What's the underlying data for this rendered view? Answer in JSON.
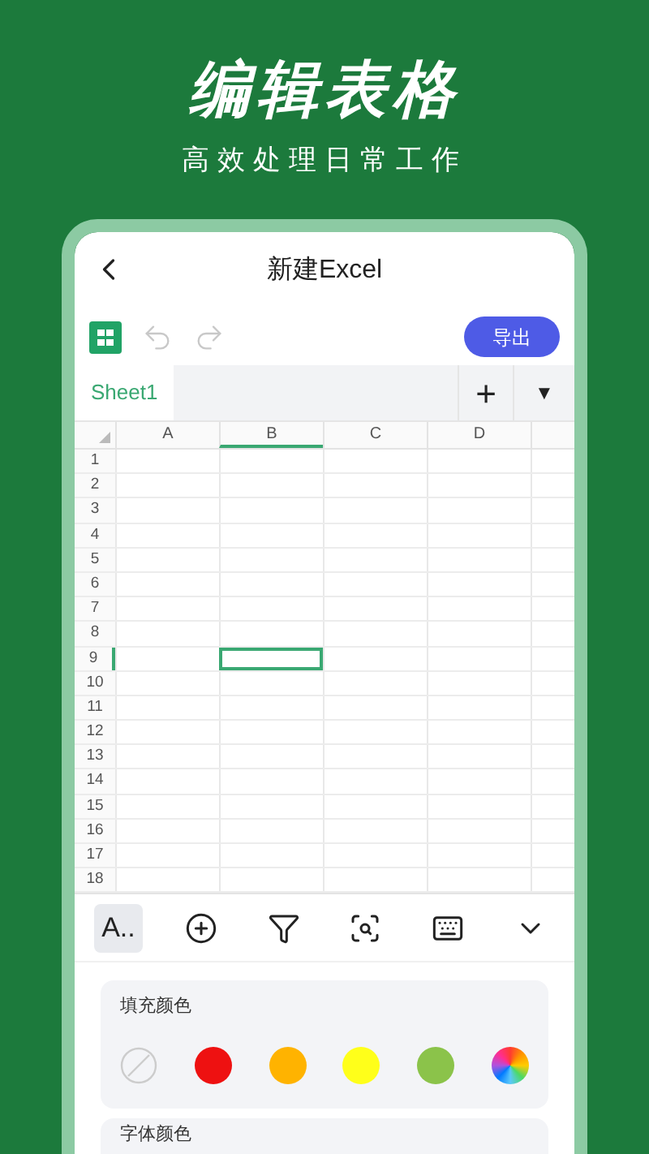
{
  "header": {
    "title": "编辑表格",
    "subtitle": "高效处理日常工作"
  },
  "screen": {
    "title": "新建Excel",
    "export_button": "导出",
    "sheet_tabs": [
      {
        "label": "Sheet1",
        "selected": true
      }
    ],
    "add_sheet": "+",
    "sheet_menu": "▼",
    "columns": [
      {
        "label": "A",
        "selected": false
      },
      {
        "label": "B",
        "selected": true
      },
      {
        "label": "C",
        "selected": false
      },
      {
        "label": "D",
        "selected": false
      }
    ],
    "rows": [
      {
        "label": "1",
        "selected": false
      },
      {
        "label": "2",
        "selected": false
      },
      {
        "label": "3",
        "selected": false
      },
      {
        "label": "4",
        "selected": false
      },
      {
        "label": "5",
        "selected": false
      },
      {
        "label": "6",
        "selected": false
      },
      {
        "label": "7",
        "selected": false
      },
      {
        "label": "8",
        "selected": false
      },
      {
        "label": "9",
        "selected": true
      },
      {
        "label": "10",
        "selected": false
      },
      {
        "label": "11",
        "selected": false
      },
      {
        "label": "12",
        "selected": false
      },
      {
        "label": "13",
        "selected": false
      },
      {
        "label": "14",
        "selected": false
      },
      {
        "label": "15",
        "selected": false
      },
      {
        "label": "16",
        "selected": false
      },
      {
        "label": "17",
        "selected": false
      },
      {
        "label": "18",
        "selected": false
      }
    ],
    "tools": [
      {
        "kind": "font",
        "label": "A..",
        "selected": true
      },
      {
        "kind": "insert",
        "selected": false
      },
      {
        "kind": "filter",
        "selected": false
      },
      {
        "kind": "find",
        "selected": false
      },
      {
        "kind": "keyboard",
        "selected": false
      },
      {
        "kind": "collapse",
        "selected": false
      }
    ],
    "fill_color": {
      "label": "填充颜色",
      "swatches": [
        {
          "kind": "none"
        },
        {
          "kind": "solid",
          "color": "#ee1111"
        },
        {
          "kind": "solid",
          "color": "#ffb300"
        },
        {
          "kind": "solid",
          "color": "#ffff1a"
        },
        {
          "kind": "solid",
          "color": "#8bc34a"
        },
        {
          "kind": "wheel"
        }
      ]
    },
    "font_color": {
      "label": "字体颜色"
    }
  }
}
